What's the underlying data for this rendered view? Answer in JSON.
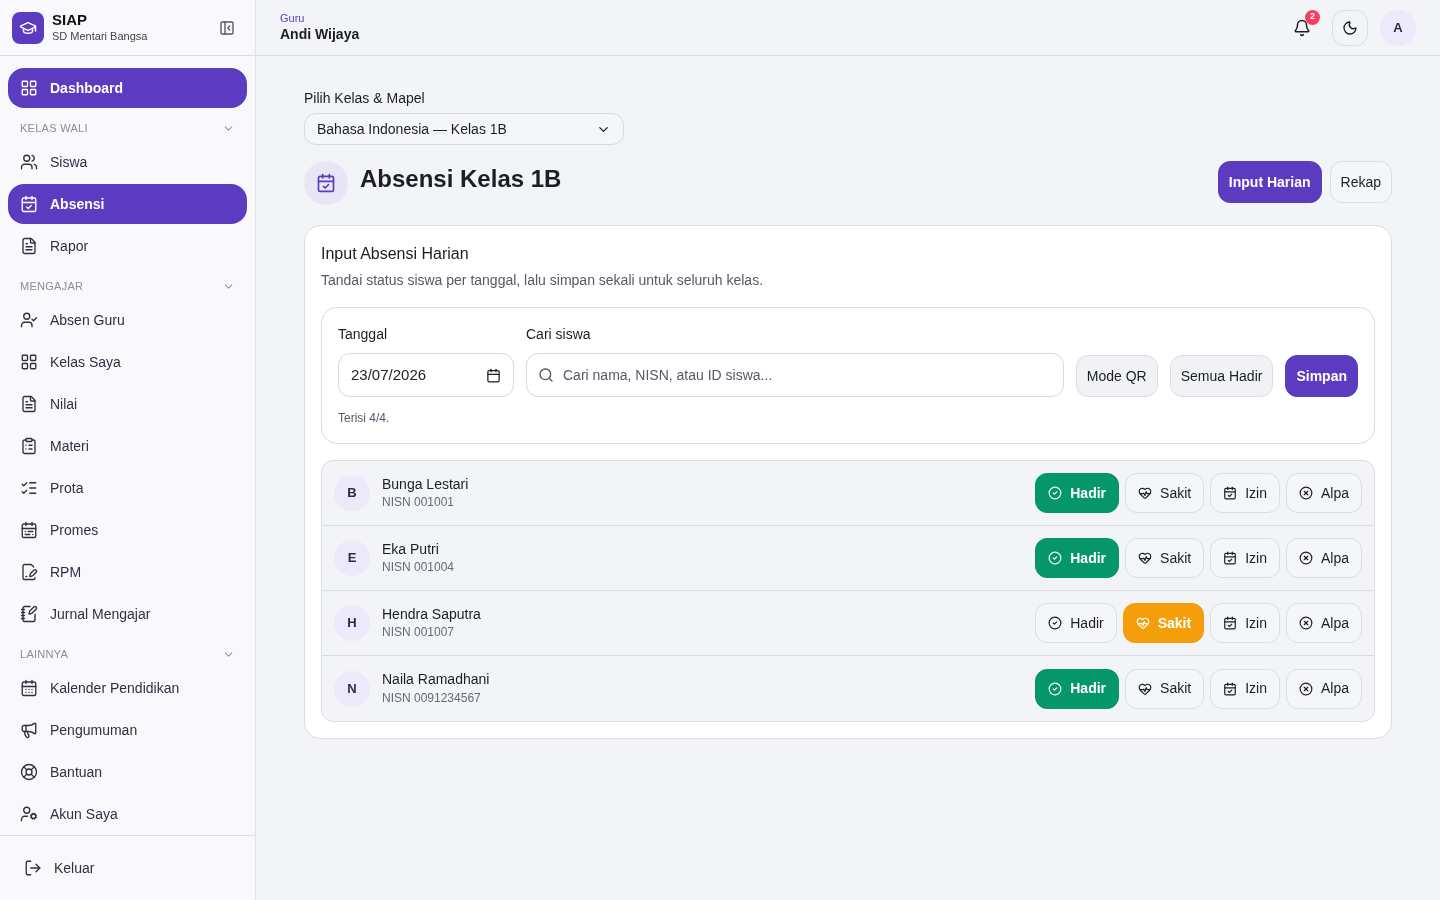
{
  "brand": {
    "name": "SIAP",
    "school": "SD Mentari Bangsa"
  },
  "sidebar": {
    "top": {
      "label": "Dashboard",
      "selected": true
    },
    "sections": [
      {
        "title": "KELAS WALI",
        "items": [
          {
            "label": "Siswa",
            "selected": false
          },
          {
            "label": "Absensi",
            "selected": true
          },
          {
            "label": "Rapor",
            "selected": false
          }
        ]
      },
      {
        "title": "MENGAJAR",
        "items": [
          {
            "label": "Absen Guru",
            "selected": false
          },
          {
            "label": "Kelas Saya",
            "selected": false
          },
          {
            "label": "Nilai",
            "selected": false
          },
          {
            "label": "Materi",
            "selected": false
          },
          {
            "label": "Prota",
            "selected": false
          },
          {
            "label": "Promes",
            "selected": false
          },
          {
            "label": "RPM",
            "selected": false
          },
          {
            "label": "Jurnal Mengajar",
            "selected": false
          }
        ]
      },
      {
        "title": "LAINNYA",
        "items": [
          {
            "label": "Kalender Pendidikan",
            "selected": false
          },
          {
            "label": "Pengumuman",
            "selected": false
          },
          {
            "label": "Bantuan",
            "selected": false
          },
          {
            "label": "Akun Saya",
            "selected": false
          }
        ]
      }
    ],
    "logout": "Keluar"
  },
  "header": {
    "role": "Guru",
    "user": "Andi Wijaya",
    "notifications": "2",
    "avatar": "A"
  },
  "picker": {
    "label": "Pilih Kelas & Mapel",
    "value": "Bahasa Indonesia — Kelas 1B"
  },
  "page": {
    "title": "Absensi Kelas 1B",
    "tabs": [
      {
        "label": "Input Harian",
        "selected": true
      },
      {
        "label": "Rekap",
        "selected": false
      }
    ]
  },
  "card": {
    "title": "Input Absensi Harian",
    "subtitle": "Tandai status siswa per tanggal, lalu simpan sekali untuk seluruh kelas.",
    "date": {
      "label": "Tanggal",
      "value": "23/07/2026"
    },
    "search": {
      "label": "Cari siswa",
      "placeholder": "Cari nama, NISN, atau ID siswa..."
    },
    "buttons": [
      {
        "label": "Mode QR",
        "kind": "secondary"
      },
      {
        "label": "Semua Hadir",
        "kind": "secondary"
      },
      {
        "label": "Simpan",
        "kind": "primary"
      }
    ],
    "filled": "Terisi 4/4."
  },
  "students": [
    {
      "initial": "B",
      "name": "Bunga Lestari",
      "nisn": "NISN 001001",
      "options": [
        {
          "kind": "hadir",
          "label": "Hadir",
          "selected": true
        },
        {
          "kind": "sakit",
          "label": "Sakit",
          "selected": false
        },
        {
          "kind": "izin",
          "label": "Izin",
          "selected": false
        },
        {
          "kind": "alpa",
          "label": "Alpa",
          "selected": false
        }
      ]
    },
    {
      "initial": "E",
      "name": "Eka Putri",
      "nisn": "NISN 001004",
      "options": [
        {
          "kind": "hadir",
          "label": "Hadir",
          "selected": true
        },
        {
          "kind": "sakit",
          "label": "Sakit",
          "selected": false
        },
        {
          "kind": "izin",
          "label": "Izin",
          "selected": false
        },
        {
          "kind": "alpa",
          "label": "Alpa",
          "selected": false
        }
      ]
    },
    {
      "initial": "H",
      "name": "Hendra Saputra",
      "nisn": "NISN 001007",
      "options": [
        {
          "kind": "hadir",
          "label": "Hadir",
          "selected": false
        },
        {
          "kind": "sakit",
          "label": "Sakit",
          "selected": true
        },
        {
          "kind": "izin",
          "label": "Izin",
          "selected": false
        },
        {
          "kind": "alpa",
          "label": "Alpa",
          "selected": false
        }
      ]
    },
    {
      "initial": "N",
      "name": "Naila Ramadhani",
      "nisn": "NISN 0091234567",
      "options": [
        {
          "kind": "hadir",
          "label": "Hadir",
          "selected": true
        },
        {
          "kind": "sakit",
          "label": "Sakit",
          "selected": false
        },
        {
          "kind": "izin",
          "label": "Izin",
          "selected": false
        },
        {
          "kind": "alpa",
          "label": "Alpa",
          "selected": false
        }
      ]
    }
  ]
}
